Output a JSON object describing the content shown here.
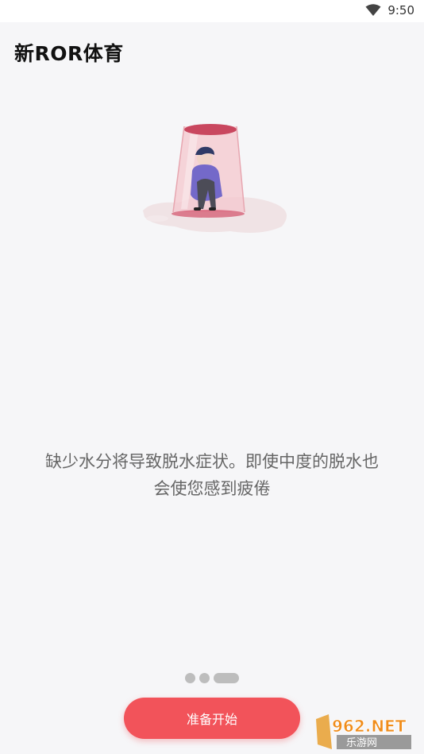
{
  "status_bar": {
    "time": "9:50",
    "wifi_icon": "wifi-icon"
  },
  "app": {
    "title": "新ROR体育"
  },
  "onboarding": {
    "message_line1": "缺少水分将导致脱水症状。即使中度的脱水也",
    "message_line2": "会使您感到疲倦",
    "illustration": "person-trapped-in-cup-illustration",
    "page_count": 3,
    "active_page": 3
  },
  "action": {
    "start_label": "准备开始"
  },
  "watermark": {
    "text_top": "962.NET",
    "text_bottom": "乐游网"
  },
  "colors": {
    "accent": "#f2535a",
    "background": "#f6f6f8",
    "dot": "#bdbdbd",
    "message": "#666666"
  }
}
